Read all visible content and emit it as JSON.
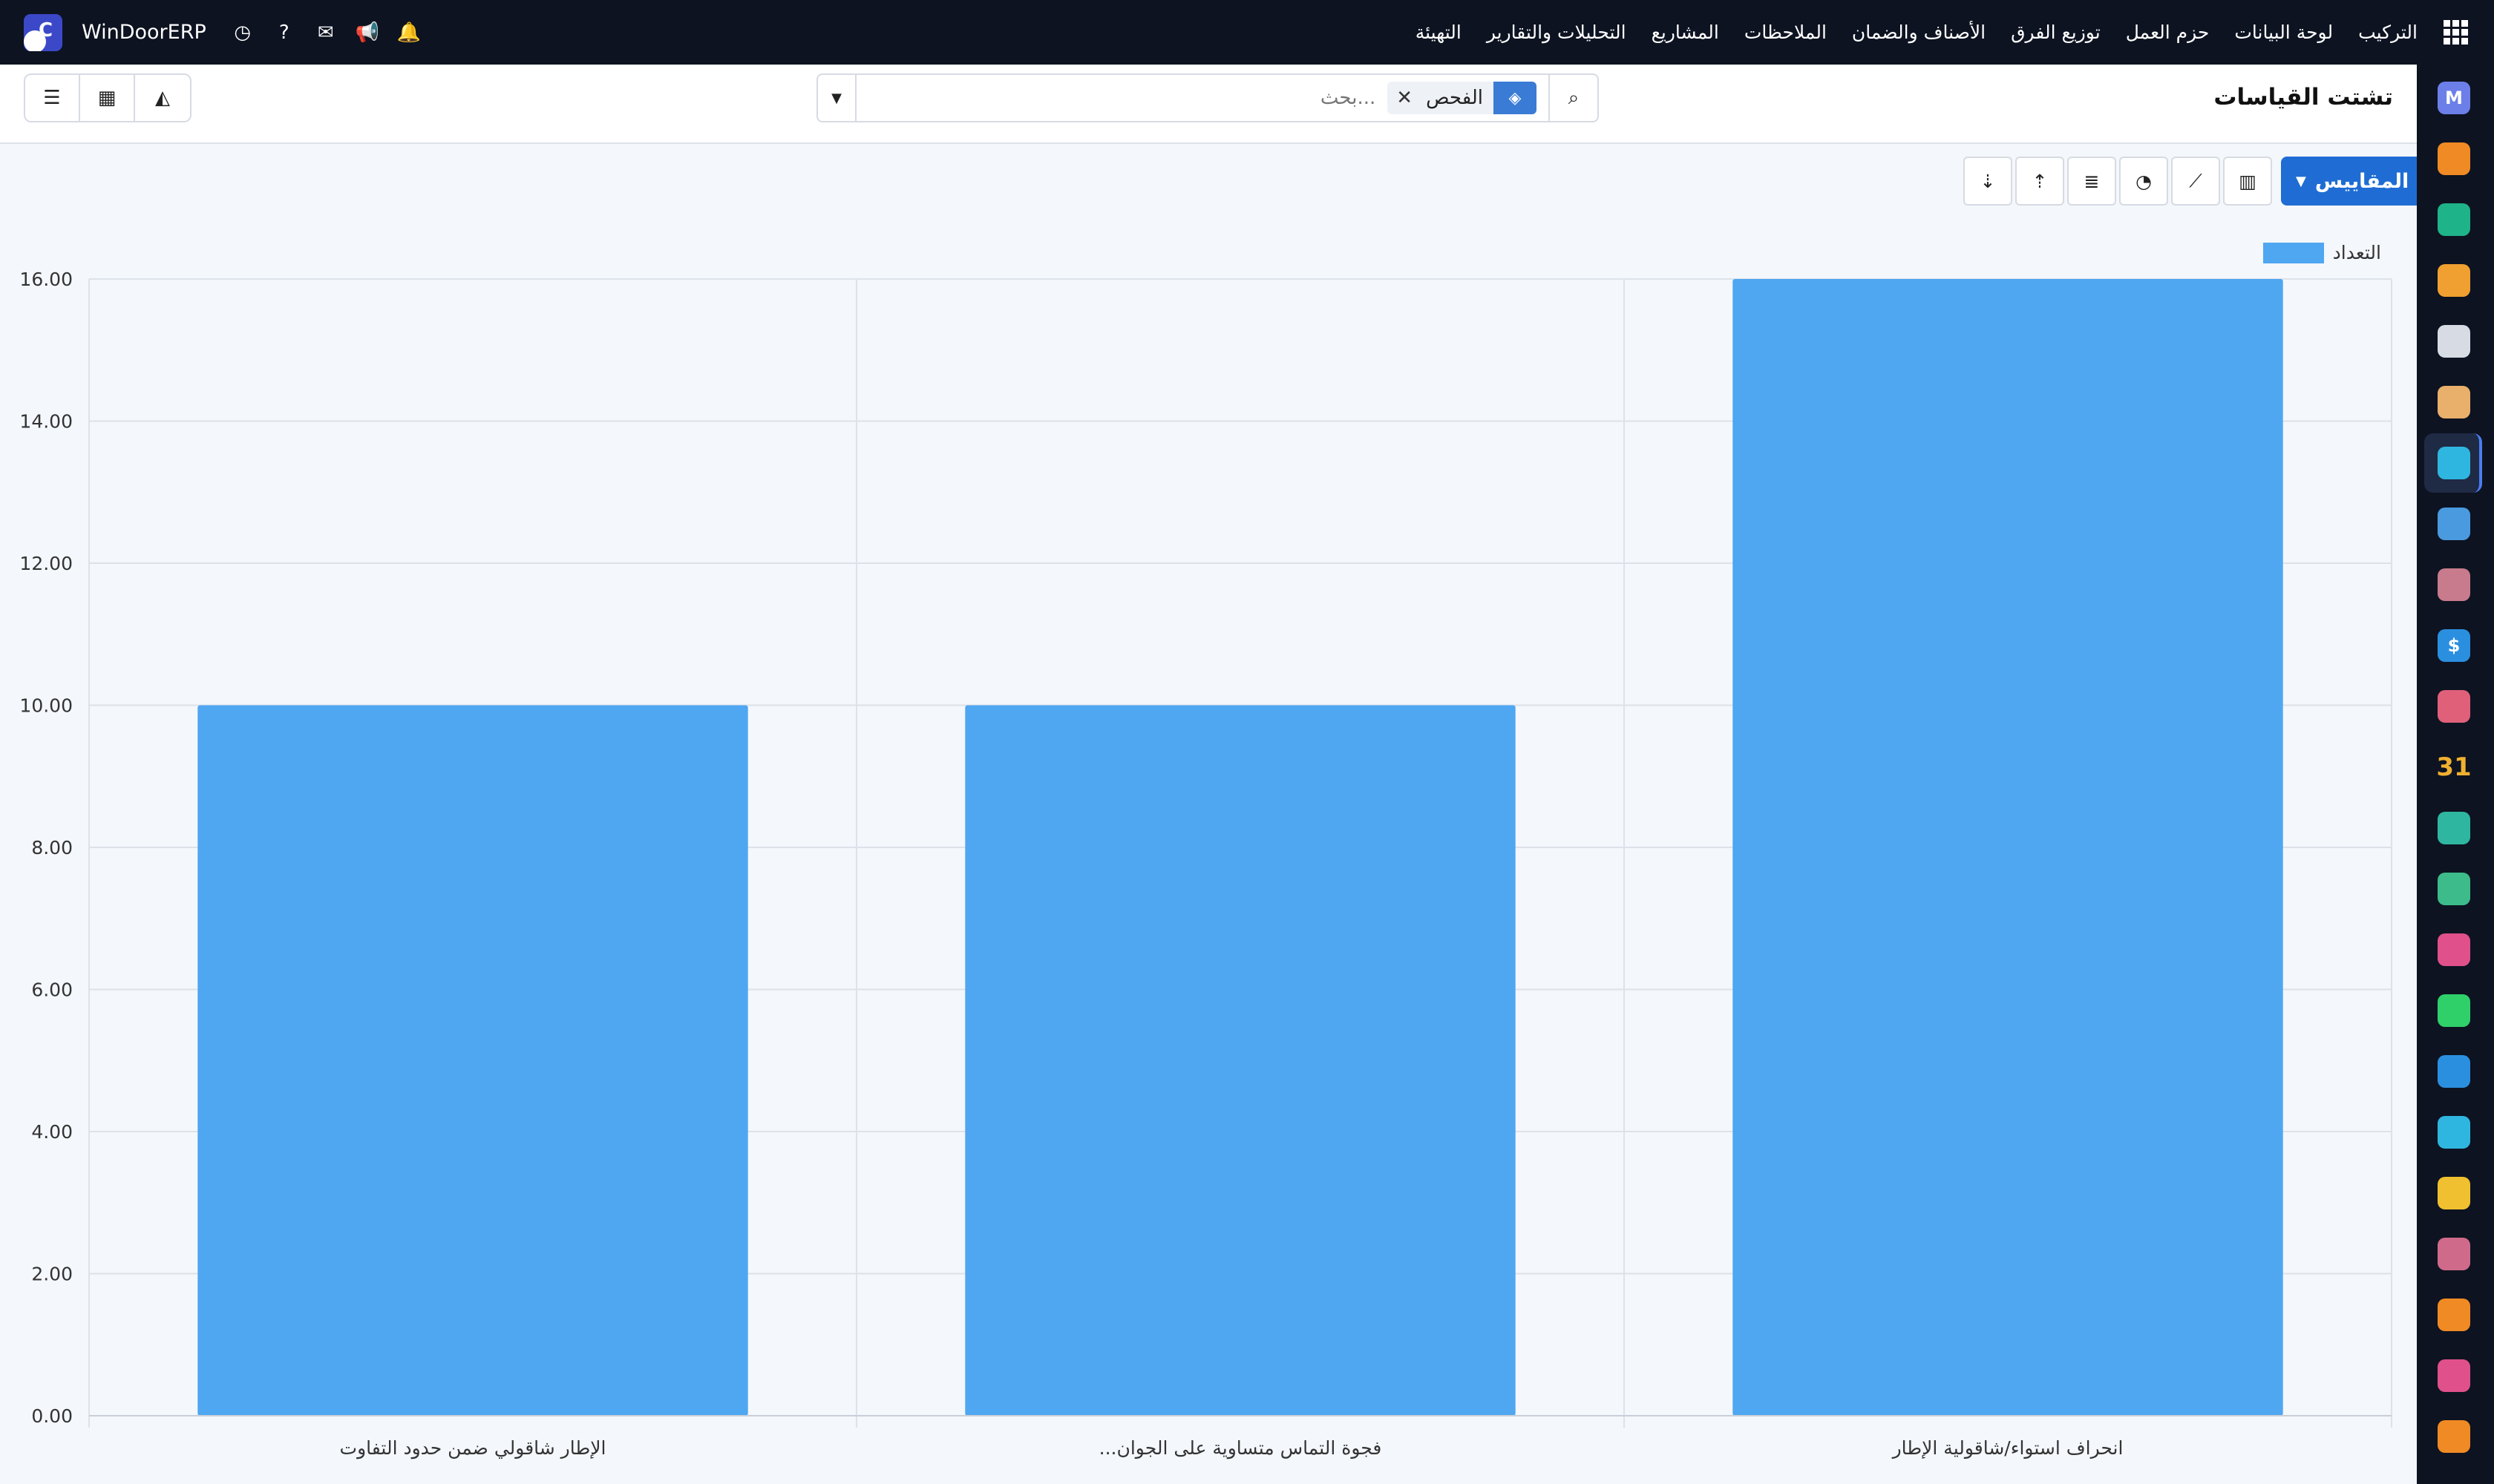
{
  "app": {
    "brand": "WinDoorERP",
    "logo_letter": "C"
  },
  "topbar": {
    "menu": [
      "التركيب",
      "لوحة البيانات",
      "حزم العمل",
      "توزيع الفرق",
      "الأصناف والضمان",
      "الملاحظات",
      "المشاريع",
      "التحليلات والتقارير",
      "التهيئة"
    ],
    "icons": [
      "clock-icon",
      "help-icon",
      "chat-icon",
      "megaphone-icon",
      "bell-icon"
    ]
  },
  "page": {
    "title": "تشتت القياسات"
  },
  "search": {
    "placeholder": "بحث...",
    "facet": "الفحص"
  },
  "toolbar": {
    "measures_label": "المقاييس"
  },
  "sidebar": {
    "apps": [
      {
        "icon": "mail-icon",
        "color": "#6c7fe8"
      },
      {
        "icon": "chat-bubble-icon",
        "color": "#f08a24"
      },
      {
        "icon": "checkmark-ribbon-icon",
        "color": "#1fb389"
      },
      {
        "icon": "bar-chart-icon",
        "color": "#f0a030"
      },
      {
        "icon": "cube-icon",
        "color": "#d7dce4"
      },
      {
        "icon": "puzzle-icon",
        "color": "#e8b06a"
      },
      {
        "icon": "check-icon",
        "color": "#2fb6e0"
      },
      {
        "icon": "book-icon",
        "color": "#4a9ae0"
      },
      {
        "icon": "box-icon",
        "color": "#c87b8c"
      },
      {
        "icon": "dollar-icon",
        "color": "#2b8fe0"
      },
      {
        "icon": "team-icon",
        "color": "#e0607a"
      },
      {
        "icon": "calendar-31-icon",
        "color": "#f0b030"
      },
      {
        "icon": "pencil-icon",
        "color": "#2fb6a0"
      },
      {
        "icon": "contact-icon",
        "color": "#3dbb8a"
      },
      {
        "icon": "dashboard-icon",
        "color": "#e0508a"
      },
      {
        "icon": "whatsapp-icon",
        "color": "#2fd06a"
      },
      {
        "icon": "compass-icon",
        "color": "#2b8fe0"
      },
      {
        "icon": "wave-icon",
        "color": "#2fb6e0"
      },
      {
        "icon": "send-icon",
        "color": "#f0c030"
      },
      {
        "icon": "layers-icon",
        "color": "#d06a8a"
      },
      {
        "icon": "hexagon-icon",
        "color": "#f08a24"
      },
      {
        "icon": "pie-icon",
        "color": "#e0508a"
      },
      {
        "icon": "gear-hex-icon",
        "color": "#f08a24"
      }
    ]
  },
  "chart_data": {
    "type": "bar",
    "categories": [
      "انحراف استواء/شاقولية الإطار",
      "فجوة التماس متساوية على الجوان...",
      "الإطار شاقولي ضمن حدود التفاوت"
    ],
    "series": [
      {
        "name": "التعداد",
        "values": [
          16,
          10,
          10
        ],
        "color": "#4fa6f1"
      }
    ],
    "ylim": [
      0,
      16
    ],
    "yticks": [
      "0.00",
      "2.00",
      "4.00",
      "6.00",
      "8.00",
      "10.00",
      "12.00",
      "14.00",
      "16.00"
    ],
    "grid": true,
    "legend_position": "top-right",
    "direction": "rtl"
  }
}
